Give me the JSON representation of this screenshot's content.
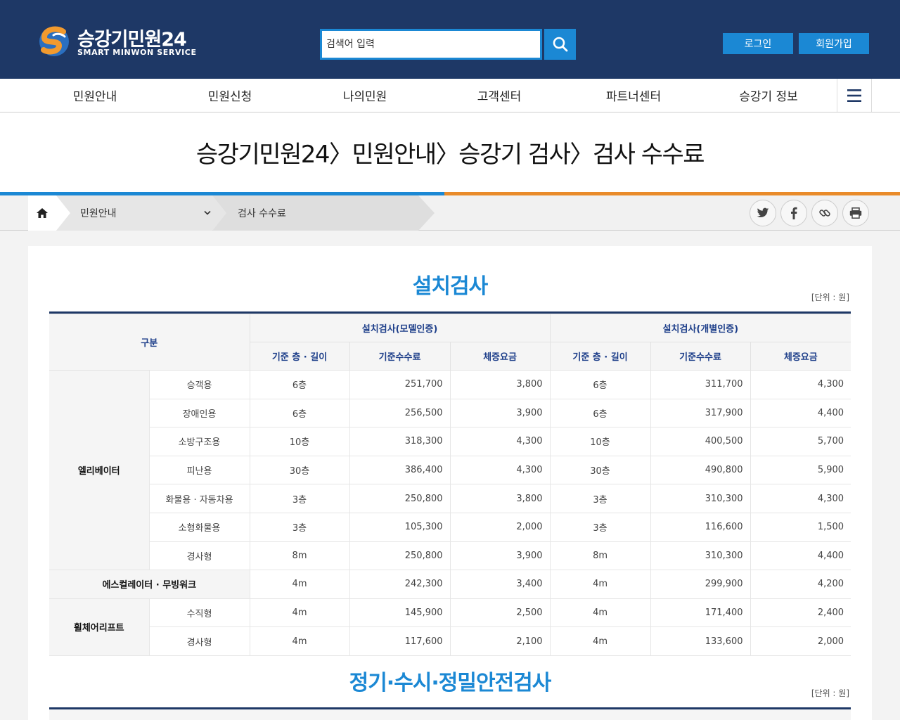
{
  "header": {
    "logo_title": "승강기민원24",
    "logo_sub": "SMART MINWON SERVICE",
    "search_placeholder": "검색어 입력",
    "login_label": "로그인",
    "join_label": "회원가입"
  },
  "gnb": {
    "items": [
      "민원안내",
      "민원신청",
      "나의민원",
      "고객센터",
      "파트너센터",
      "승강기 정보"
    ]
  },
  "page_title": "승강기민원24〉민원안내〉승강기 검사〉검사 수수료",
  "breadcrumb": {
    "level1": "민원안내",
    "level2": "검사 수수료"
  },
  "colors": {
    "navy": "#1e3866",
    "blue": "#1b88d4",
    "orange": "#e98b2a"
  },
  "section1": {
    "title": "설치검사",
    "unit": "[단위 : 원]",
    "headers": {
      "category": "구분",
      "group_model": "설치검사(모델인증)",
      "group_individual": "설치검사(개별인증)",
      "floor_length": "기준 층 · 길이",
      "base_fee": "기준수수료",
      "extra_fee": "체증요금"
    },
    "categories": {
      "elevator": "엘리베이터",
      "escalator": "에스컬레이터 · 무빙워크",
      "wheelchair": "휠체어리프트"
    },
    "rows": [
      {
        "sub": "승객용",
        "m_floor": "6층",
        "m_fee": "251,700",
        "m_extra": "3,800",
        "i_floor": "6층",
        "i_fee": "311,700",
        "i_extra": "4,300"
      },
      {
        "sub": "장애인용",
        "m_floor": "6층",
        "m_fee": "256,500",
        "m_extra": "3,900",
        "i_floor": "6층",
        "i_fee": "317,900",
        "i_extra": "4,400"
      },
      {
        "sub": "소방구조용",
        "m_floor": "10층",
        "m_fee": "318,300",
        "m_extra": "4,300",
        "i_floor": "10층",
        "i_fee": "400,500",
        "i_extra": "5,700"
      },
      {
        "sub": "피난용",
        "m_floor": "30층",
        "m_fee": "386,400",
        "m_extra": "4,300",
        "i_floor": "30층",
        "i_fee": "490,800",
        "i_extra": "5,900"
      },
      {
        "sub": "화물용 · 자동차용",
        "m_floor": "3층",
        "m_fee": "250,800",
        "m_extra": "3,800",
        "i_floor": "3층",
        "i_fee": "310,300",
        "i_extra": "4,300"
      },
      {
        "sub": "소형화물용",
        "m_floor": "3층",
        "m_fee": "105,300",
        "m_extra": "2,000",
        "i_floor": "3층",
        "i_fee": "116,600",
        "i_extra": "1,500"
      },
      {
        "sub": "경사형",
        "m_floor": "8m",
        "m_fee": "250,800",
        "m_extra": "3,900",
        "i_floor": "8m",
        "i_fee": "310,300",
        "i_extra": "4,400"
      },
      {
        "sub": "",
        "m_floor": "4m",
        "m_fee": "242,300",
        "m_extra": "3,400",
        "i_floor": "4m",
        "i_fee": "299,900",
        "i_extra": "4,200"
      },
      {
        "sub": "수직형",
        "m_floor": "4m",
        "m_fee": "145,900",
        "m_extra": "2,500",
        "i_floor": "4m",
        "i_fee": "171,400",
        "i_extra": "2,400"
      },
      {
        "sub": "경사형",
        "m_floor": "4m",
        "m_fee": "117,600",
        "m_extra": "2,100",
        "i_floor": "4m",
        "i_fee": "133,600",
        "i_extra": "2,000"
      }
    ]
  },
  "section2": {
    "title": "정기·수시·정밀안전검사",
    "unit": "[단위 : 원]"
  }
}
